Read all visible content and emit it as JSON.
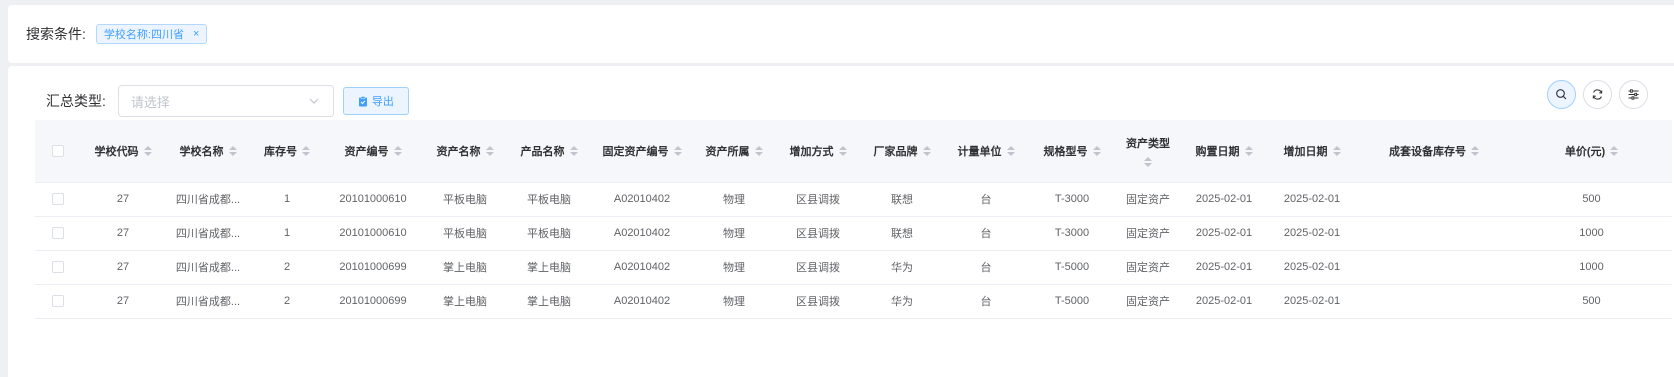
{
  "search": {
    "label": "搜索条件:",
    "tag": "学校名称:四川省",
    "tag_close": "×"
  },
  "filter": {
    "label": "汇总类型:",
    "select_placeholder": "请选择",
    "export_label": "导出"
  },
  "toolbar": {
    "icons": [
      "search-icon",
      "refresh-icon",
      "column-settings-icon"
    ]
  },
  "colors": {
    "accent": "#409eff",
    "tag_bg": "#ecf5ff",
    "header_bg": "#f5f7fa",
    "page_bg": "#eef0f4"
  },
  "table": {
    "columns": [
      "学校代码",
      "学校名称",
      "库存号",
      "资产编号",
      "资产名称",
      "产品名称",
      "固定资产编号",
      "资产所属",
      "增加方式",
      "厂家品牌",
      "计量单位",
      "规格型号",
      "资产类型",
      "购置日期",
      "增加日期",
      "成套设备库存号",
      "单价(元)"
    ],
    "rows": [
      [
        "27",
        "四川省成都...",
        "1",
        "20101000610",
        "平板电脑",
        "平板电脑",
        "A02010402",
        "物理",
        "区县调拨",
        "联想",
        "台",
        "T-3000",
        "固定资产",
        "2025-02-01",
        "2025-02-01",
        "",
        "500"
      ],
      [
        "27",
        "四川省成都...",
        "1",
        "20101000610",
        "平板电脑",
        "平板电脑",
        "A02010402",
        "物理",
        "区县调拨",
        "联想",
        "台",
        "T-3000",
        "固定资产",
        "2025-02-01",
        "2025-02-01",
        "",
        "1000"
      ],
      [
        "27",
        "四川省成都...",
        "2",
        "20101000699",
        "掌上电脑",
        "掌上电脑",
        "A02010402",
        "物理",
        "区县调拨",
        "华为",
        "台",
        "T-5000",
        "固定资产",
        "2025-02-01",
        "2025-02-01",
        "",
        "1000"
      ],
      [
        "27",
        "四川省成都...",
        "2",
        "20101000699",
        "掌上电脑",
        "掌上电脑",
        "A02010402",
        "物理",
        "区县调拨",
        "华为",
        "台",
        "T-5000",
        "固定资产",
        "2025-02-01",
        "2025-02-01",
        "",
        "500"
      ]
    ]
  }
}
